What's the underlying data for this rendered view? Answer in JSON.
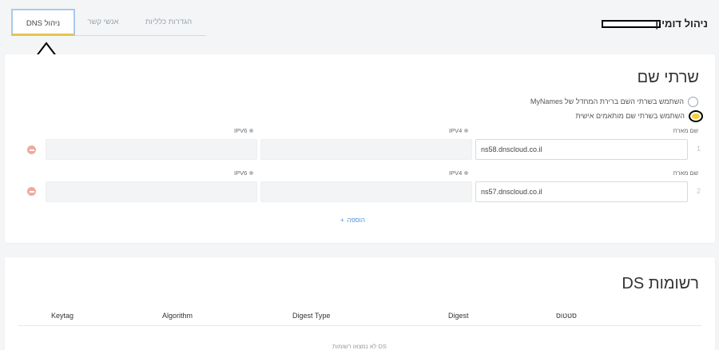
{
  "header": {
    "title": "ניהול דומיין"
  },
  "tabs": [
    {
      "label": "הגדרות כלליות",
      "active": false
    },
    {
      "label": "אנשי קשר",
      "active": false
    },
    {
      "label": "ניהול DNS",
      "active": true
    }
  ],
  "nameservers": {
    "title": "שרתי שם",
    "options": [
      {
        "label": "השתמש בשרתי השם ברירת המחדל של MyNames",
        "selected": false
      },
      {
        "label": "השתמש בשרתי שם מותאמים אישית",
        "selected": true
      }
    ],
    "columns": {
      "host": "שם מארח",
      "ipv4": "IPV4",
      "ipv6": "IPV6"
    },
    "rows": [
      {
        "num": "1",
        "host": "ns58.dnscloud.co.il",
        "ipv4": "",
        "ipv6": ""
      },
      {
        "num": "2",
        "host": "ns57.dnscloud.co.il",
        "ipv4": "",
        "ipv6": ""
      }
    ],
    "add_label": "הוספה",
    "add_icon": "+"
  },
  "ds_records": {
    "title": "רשומות DS",
    "columns": [
      "Keytag",
      "Algorithm",
      "Digest Type",
      "Digest",
      "סטטוס"
    ],
    "empty_text": "DS לא נמצאו רשומות"
  },
  "colors": {
    "accent": "#4a90d9",
    "active_tab_border": "#a9c9ea",
    "active_tab_underline": "#e6c54a",
    "radio_selected": "#f2cf3e",
    "remove": "#f1a99f"
  }
}
